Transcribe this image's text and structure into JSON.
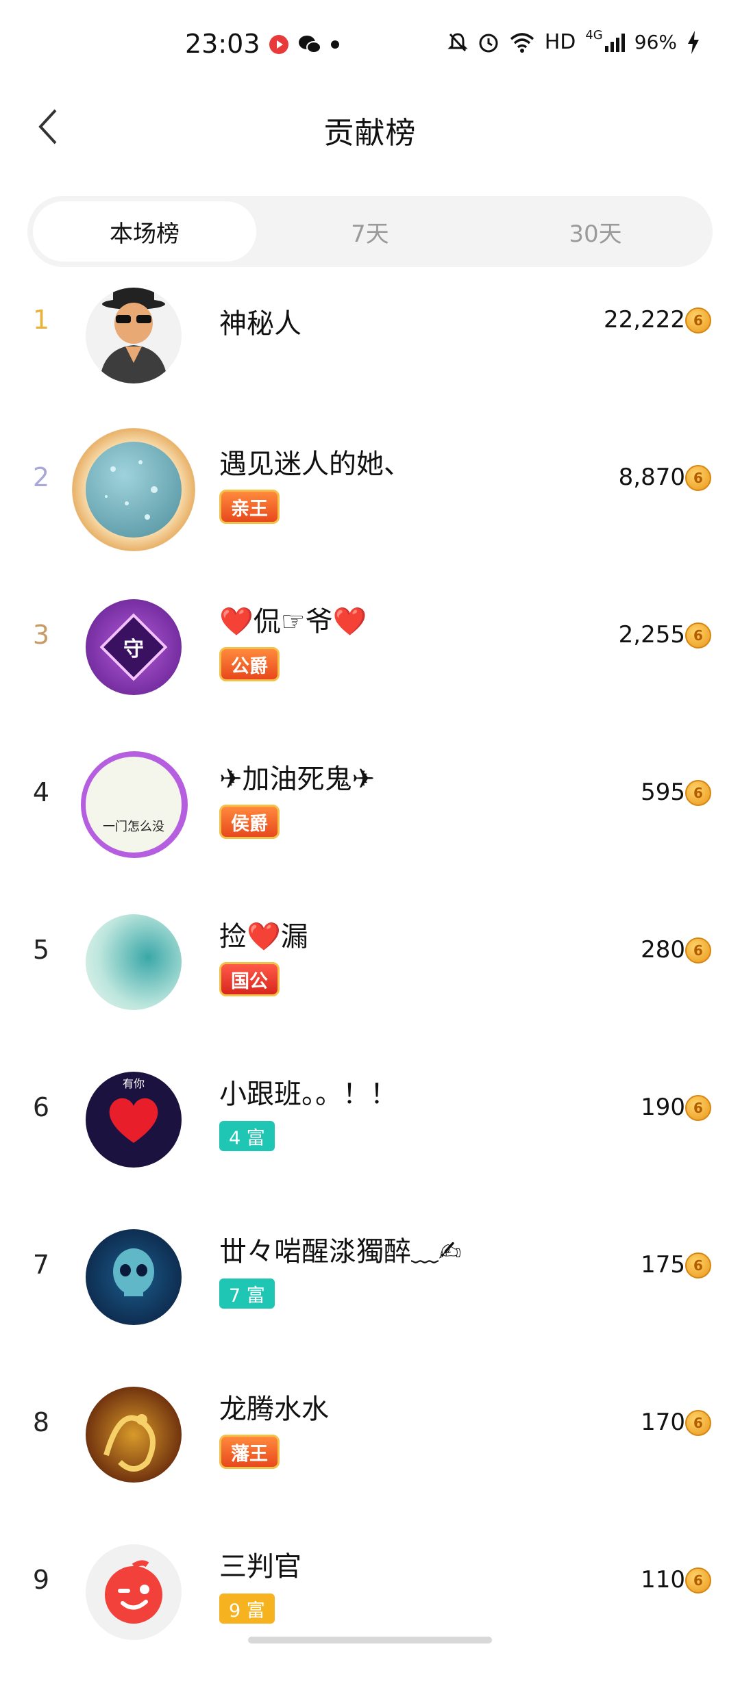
{
  "status": {
    "time": "23:03",
    "hd": "HD",
    "network": "4G",
    "battery": "96%"
  },
  "header": {
    "title": "贡献榜"
  },
  "tabs": [
    {
      "label": "本场榜",
      "active": true
    },
    {
      "label": "7天",
      "active": false
    },
    {
      "label": "30天",
      "active": false
    }
  ],
  "rows": [
    {
      "rank": "1",
      "name": "神秘人",
      "badge": "",
      "score": "22,222"
    },
    {
      "rank": "2",
      "name": "遇见迷人的她、",
      "badge": "亲王",
      "score": "8,870"
    },
    {
      "rank": "3",
      "name": "❤️侃☞爷❤️",
      "badge": "公爵",
      "score": "2,255"
    },
    {
      "rank": "4",
      "name": "✈加油死鬼✈",
      "badge": "侯爵",
      "score": "595"
    },
    {
      "rank": "5",
      "name": "捡❤️漏",
      "badge": "国公",
      "score": "280"
    },
    {
      "rank": "6",
      "name": "小跟班。。！！",
      "badge": "4 富",
      "score": "190"
    },
    {
      "rank": "7",
      "name": "丗々啱醒渁獨醉﹏✍",
      "badge": "7 富",
      "score": "175"
    },
    {
      "rank": "8",
      "name": "龙腾水水",
      "badge": "藩王",
      "score": "170"
    },
    {
      "rank": "9",
      "name": "三判官",
      "badge": "9 富",
      "score": "110"
    }
  ],
  "avatar_texts": {
    "row3_emblem": "守",
    "row4_text": "一门怎么没",
    "row6_text": "有你"
  },
  "icons": {
    "back": "chevron-left-icon",
    "coin": "coin-icon",
    "coin_glyph": "6"
  },
  "colors": {
    "rank1": "#e9b23a",
    "rank2": "#a9a7d6",
    "rank3": "#c89a64",
    "rich_badge": "#1fc6b3",
    "rich_badge_gold": "#f6b21f",
    "coin": "#e9981b"
  }
}
